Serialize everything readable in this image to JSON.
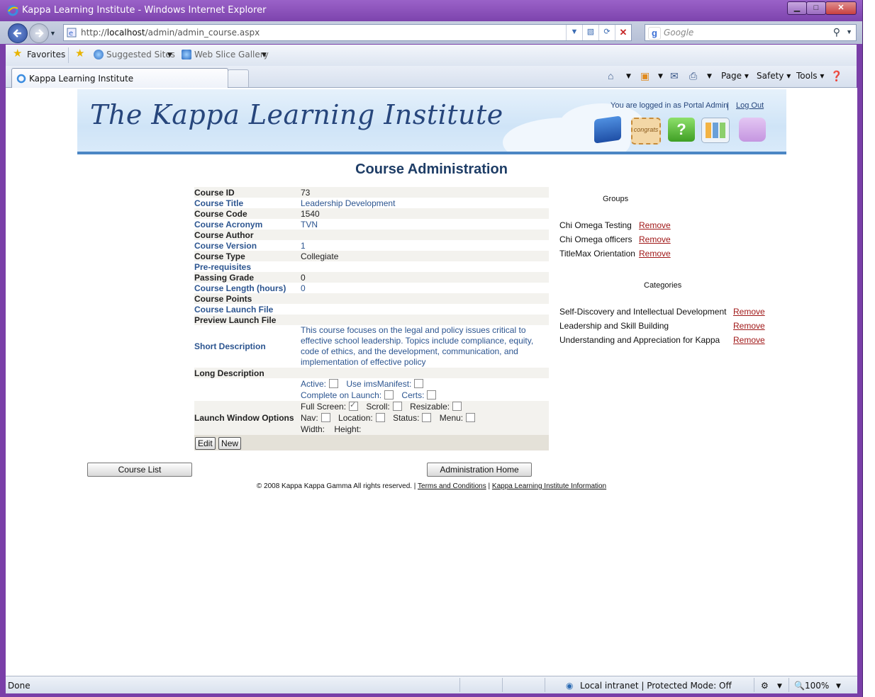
{
  "browser": {
    "window_title": "Kappa Learning Institute - Windows Internet Explorer",
    "url_prefix": "http://",
    "url_host": "localhost",
    "url_path": "/admin/admin_course.aspx",
    "search_placeholder": "Google",
    "favorites": {
      "favorites_label": "Favorites",
      "suggested_sites": "Suggested Sites",
      "web_slice_gallery": "Web Slice Gallery"
    },
    "tab_title": "Kappa Learning Institute",
    "commands": {
      "page": "Page",
      "safety": "Safety",
      "tools": "Tools"
    },
    "status": {
      "left": "Done",
      "zone": "Local intranet | Protected Mode: Off",
      "zoom": "100%"
    }
  },
  "header": {
    "logo_text": "The Kappa Learning Institute",
    "login_text": "You are logged in as Portal Admin",
    "logout_label": "Log Out",
    "stamp_text": "congrats"
  },
  "page": {
    "title": "Course Administration"
  },
  "course": {
    "rows": [
      {
        "label": "Course ID",
        "value": "73"
      },
      {
        "label": "Course Title",
        "value": "Leadership Development"
      },
      {
        "label": "Course Code",
        "value": "1540"
      },
      {
        "label": "Course Acronym",
        "value": "TVN"
      },
      {
        "label": "Course Author",
        "value": ""
      },
      {
        "label": "Course Version",
        "value": "1"
      },
      {
        "label": "Course Type",
        "value": "Collegiate"
      },
      {
        "label": "Pre-requisites",
        "value": ""
      },
      {
        "label": "Passing Grade",
        "value": "0"
      },
      {
        "label": "Course Length (hours)",
        "value": "0"
      },
      {
        "label": "Course Points",
        "value": ""
      },
      {
        "label": "Course Launch File",
        "value": ""
      },
      {
        "label": "Preview Launch File",
        "value": ""
      }
    ],
    "short_description_label": "Short Description",
    "short_description": "This course focuses on the legal and policy issues critical to effective school leadership. Topics include compliance, equity, code of ethics, and the development, communication, and implementation of effective policy",
    "long_description_label": "Long Description",
    "options": {
      "active": "Active:",
      "ims_manifest": "Use imsManifest:",
      "complete_on_launch": "Complete on Launch:",
      "certs": "Certs:"
    },
    "launch_window_label": "Launch Window Options",
    "launch": {
      "full_screen": "Full Screen:",
      "full_screen_checked": true,
      "scroll": "Scroll:",
      "resizable": "Resizable:",
      "nav": "Nav:",
      "location": "Location:",
      "status": "Status:",
      "menu": "Menu:",
      "width": "Width:",
      "height": "Height:"
    },
    "edit_label": "Edit",
    "new_label": "New"
  },
  "groups": {
    "heading": "Groups",
    "items": [
      "Chi Omega Testing",
      "Chi Omega officers",
      "TitleMax Orientation"
    ],
    "remove_label": "Remove"
  },
  "categories": {
    "heading": "Categories",
    "items": [
      "Self-Discovery and Intellectual Development",
      "Leadership and Skill Building",
      "Understanding and Appreciation for Kappa"
    ],
    "remove_label": "Remove"
  },
  "actions": {
    "course_list": "Course List",
    "admin_home": "Administration Home"
  },
  "footer": {
    "copyright": "© 2008 Kappa Kappa Gamma All rights reserved. |",
    "terms": "Terms and Conditions",
    "separator": "|",
    "info": "Kappa Learning Institute Information"
  },
  "colors": {
    "title_blue": "#1e3d66",
    "label_blue": "#2c5590",
    "remove_red": "#a01818",
    "banner_bar": "#4b86c4",
    "window_frame": "#7a3fa8"
  }
}
